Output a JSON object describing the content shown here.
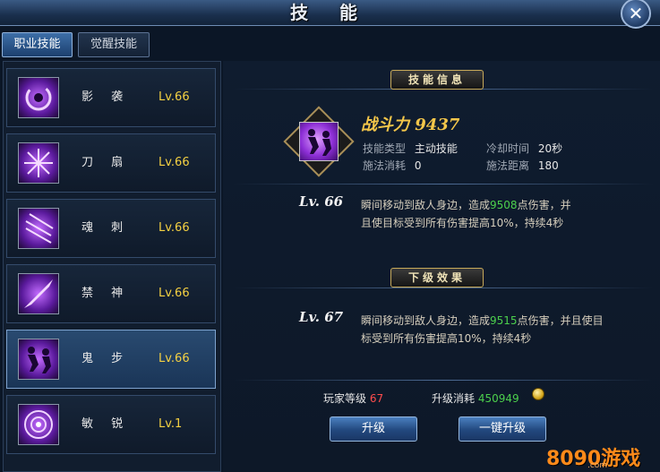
{
  "window": {
    "title": "技 能",
    "close_label": "✕"
  },
  "tabs": [
    {
      "label": "职业技能",
      "active": true
    },
    {
      "label": "觉醒技能",
      "active": false
    }
  ],
  "skills": [
    {
      "name": "影 袭",
      "level": "Lv.66",
      "icon": "shadow-swirl-icon"
    },
    {
      "name": "刀 扇",
      "level": "Lv.66",
      "icon": "blade-fan-icon"
    },
    {
      "name": "魂 刺",
      "level": "Lv.66",
      "icon": "soul-stab-icon"
    },
    {
      "name": "禁 神",
      "level": "Lv.66",
      "icon": "forbidden-spirit-icon"
    },
    {
      "name": "鬼 步",
      "level": "Lv.66",
      "icon": "ghost-step-icon",
      "selected": true
    },
    {
      "name": "敏 锐",
      "level": "Lv.1",
      "icon": "keen-eye-icon"
    }
  ],
  "detail": {
    "section_title": "技能信息",
    "power_label": "战斗力",
    "power_value": "9437",
    "type_label": "技能类型",
    "type_value": "主动技能",
    "cooldown_label": "冷却时间",
    "cooldown_value": "20秒",
    "cost_label": "施法消耗",
    "cost_value": "0",
    "range_label": "施法距离",
    "range_value": "180",
    "current_level": "Lv. 66",
    "current_desc_a": "瞬间移动到敌人身边，造成",
    "current_desc_dmg": "9508",
    "current_desc_b": "点伤害，并",
    "current_desc_c": "且使目标受到所有伤害提高10%，持续4秒"
  },
  "next": {
    "section_title": "下级效果",
    "level": "Lv. 67",
    "desc_a": "瞬间移动到敌人身边，造成",
    "desc_dmg": "9515",
    "desc_b": "点伤害，并且使目",
    "desc_c": "标受到所有伤害提高10%，持续4秒"
  },
  "footer": {
    "player_level_label": "玩家等级",
    "player_level_value": "67",
    "upgrade_cost_label": "升级消耗",
    "upgrade_cost_value": "450949",
    "upgrade_button": "升级",
    "one_click_button": "一键升级"
  },
  "watermark": {
    "text": "8090游戏",
    "sub": ".com"
  },
  "colors": {
    "level_yellow": "#f5d142",
    "damage_green": "#4cd04c",
    "warn_red": "#ff4d4d",
    "power_gold": "#f3c64a"
  }
}
